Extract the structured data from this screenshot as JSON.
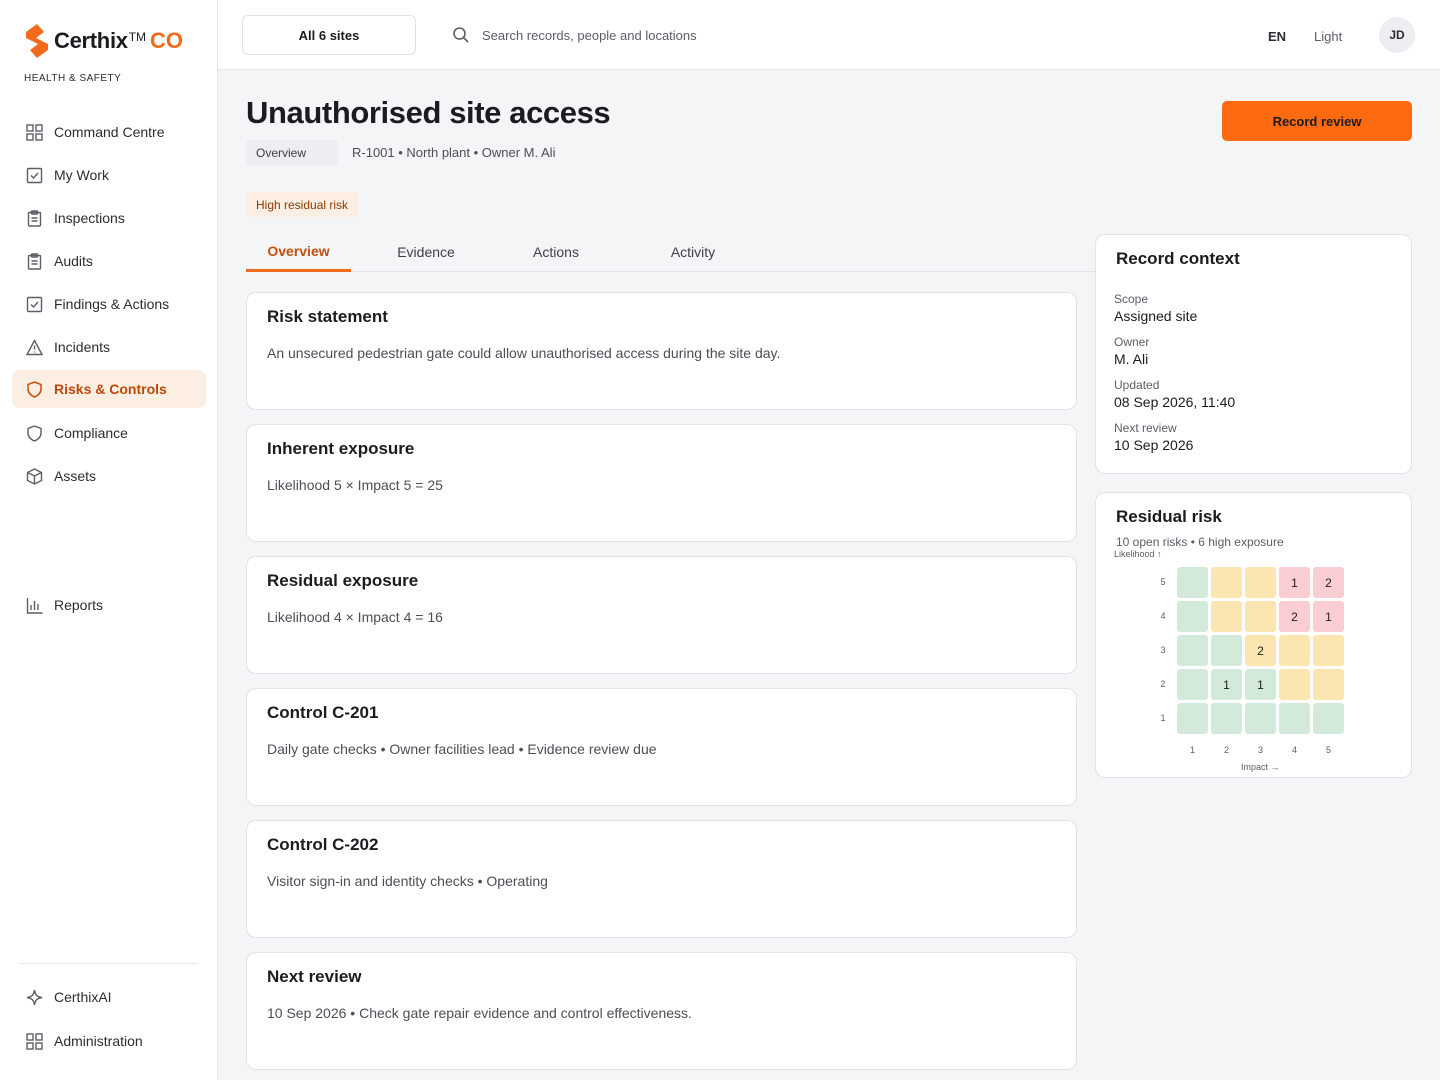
{
  "brand": {
    "name": "Certhix",
    "tm": "TM",
    "suffix": "CO",
    "subtitle": "HEALTH & SAFETY"
  },
  "nav": {
    "items": [
      {
        "label": "Command Centre",
        "icon": "grid-icon"
      },
      {
        "label": "My Work",
        "icon": "checkbox-icon"
      },
      {
        "label": "Inspections",
        "icon": "clipboard-icon"
      },
      {
        "label": "Audits",
        "icon": "clipboard-icon"
      },
      {
        "label": "Findings & Actions",
        "icon": "checkbox-icon"
      },
      {
        "label": "Incidents",
        "icon": "warning-icon"
      },
      {
        "label": "Risks & Controls",
        "icon": "shield-icon",
        "active": true
      },
      {
        "label": "Compliance",
        "icon": "shield-icon"
      },
      {
        "label": "Assets",
        "icon": "cube-icon"
      },
      {
        "label": "Reports",
        "icon": "bar-chart-icon"
      }
    ],
    "footer": [
      {
        "label": "CerthixAI",
        "icon": "sparkle-icon"
      },
      {
        "label": "Administration",
        "icon": "grid-icon"
      }
    ]
  },
  "topbar": {
    "site_selector": "All 6 sites",
    "search_placeholder": "Search records, people and locations",
    "language": "EN",
    "theme": "Light",
    "avatar_initials": "JD"
  },
  "record": {
    "title": "Unauthorised site access",
    "primary_action": "Record review",
    "section_chip": "Overview",
    "meta": "R-1001 • North plant • Owner M. Ali",
    "badge": "High residual risk"
  },
  "tabs": [
    "Overview",
    "Evidence",
    "Actions",
    "Activity"
  ],
  "cards": [
    {
      "title": "Risk statement",
      "body": "An unsecured pedestrian gate could allow unauthorised access during the site day."
    },
    {
      "title": "Inherent exposure",
      "body": "Likelihood 5 × Impact 5 = 25"
    },
    {
      "title": "Residual exposure",
      "body": "Likelihood 4 × Impact 4 = 16"
    },
    {
      "title": "Control C-201",
      "body": "Daily gate checks • Owner facilities lead • Evidence review due"
    },
    {
      "title": "Control C-202",
      "body": "Visitor sign-in and identity checks • Operating"
    },
    {
      "title": "Next review",
      "body": "10 Sep 2026 • Check gate repair evidence and control effectiveness."
    }
  ],
  "context": {
    "title": "Record context",
    "fields": [
      {
        "label": "Scope",
        "value": "Assigned site"
      },
      {
        "label": "Owner",
        "value": "M. Ali"
      },
      {
        "label": "Updated",
        "value": "08 Sep 2026, 11:40"
      },
      {
        "label": "Next review",
        "value": "10 Sep 2026"
      }
    ]
  },
  "residual_risk": {
    "title": "Residual risk",
    "summary": "10 open risks • 6 high exposure",
    "y_axis_label": "Likelihood ↑",
    "x_axis_label": "Impact →",
    "levels": [
      "1",
      "2",
      "3",
      "4",
      "5"
    ],
    "colors": {
      "low": "#d3eadb",
      "medium": "#fbe5b0",
      "high": "#f9cdd2"
    },
    "rows": [
      {
        "likelihood": "5",
        "cells": [
          {
            "band": "low",
            "count": ""
          },
          {
            "band": "medium",
            "count": ""
          },
          {
            "band": "medium",
            "count": ""
          },
          {
            "band": "high",
            "count": "1"
          },
          {
            "band": "high",
            "count": "2"
          }
        ]
      },
      {
        "likelihood": "4",
        "cells": [
          {
            "band": "low",
            "count": ""
          },
          {
            "band": "medium",
            "count": ""
          },
          {
            "band": "medium",
            "count": ""
          },
          {
            "band": "high",
            "count": "2"
          },
          {
            "band": "high",
            "count": "1"
          }
        ]
      },
      {
        "likelihood": "3",
        "cells": [
          {
            "band": "low",
            "count": ""
          },
          {
            "band": "low",
            "count": ""
          },
          {
            "band": "medium",
            "count": "2"
          },
          {
            "band": "medium",
            "count": ""
          },
          {
            "band": "medium",
            "count": ""
          }
        ]
      },
      {
        "likelihood": "2",
        "cells": [
          {
            "band": "low",
            "count": ""
          },
          {
            "band": "low",
            "count": "1"
          },
          {
            "band": "low",
            "count": "1"
          },
          {
            "band": "medium",
            "count": ""
          },
          {
            "band": "medium",
            "count": ""
          }
        ]
      },
      {
        "likelihood": "1",
        "cells": [
          {
            "band": "low",
            "count": ""
          },
          {
            "band": "low",
            "count": ""
          },
          {
            "band": "low",
            "count": ""
          },
          {
            "band": "low",
            "count": ""
          },
          {
            "band": "low",
            "count": ""
          }
        ]
      }
    ]
  }
}
